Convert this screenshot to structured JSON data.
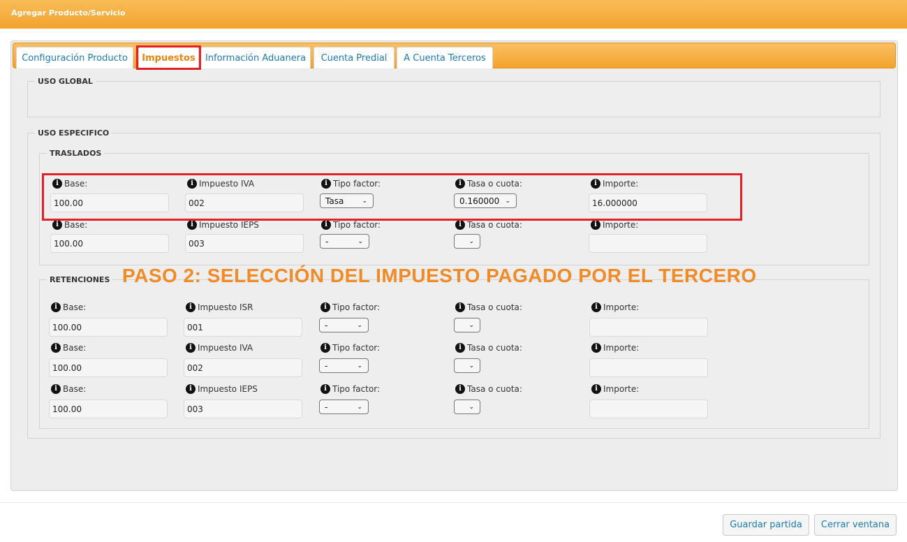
{
  "window": {
    "title": "Agregar Producto/Servicio"
  },
  "tabs": [
    {
      "label": "Configuración Producto"
    },
    {
      "label": "Impuestos"
    },
    {
      "label": "Información Aduanera"
    },
    {
      "label": "Cuenta Predial"
    },
    {
      "label": "A Cuenta Terceros"
    }
  ],
  "uso_global": {
    "legend": "USO GLOBAL"
  },
  "uso_especifico": {
    "legend": "USO ESPECIFICO"
  },
  "traslados": {
    "legend": "TRASLADOS",
    "rows": [
      {
        "base_label": "Base:",
        "base": "100.00",
        "impuesto_label": "Impuesto IVA",
        "impuesto": "002",
        "tipo_label": "Tipo factor:",
        "tipo": "Tasa",
        "tasa_label": "Tasa o cuota:",
        "tasa": "0.160000",
        "importe_label": "Importe:",
        "importe": "16.000000"
      },
      {
        "base_label": "Base:",
        "base": "100.00",
        "impuesto_label": "Impuesto IEPS",
        "impuesto": "003",
        "tipo_label": "Tipo factor:",
        "tipo": "-",
        "tasa_label": "Tasa o cuota:",
        "tasa": "",
        "importe_label": "Importe:",
        "importe": ""
      }
    ]
  },
  "overlay": {
    "text": "PASO 2: SELECCIÓN DEL IMPUESTO PAGADO POR EL TERCERO"
  },
  "retenciones": {
    "legend": "RETENCIONES",
    "rows": [
      {
        "base_label": "Base:",
        "base": "100.00",
        "impuesto_label": "Impuesto ISR",
        "impuesto": "001",
        "tipo_label": "Tipo factor:",
        "tipo": "-",
        "tasa_label": "Tasa o cuota:",
        "tasa": "",
        "importe_label": "Importe:",
        "importe": ""
      },
      {
        "base_label": "Base:",
        "base": "100.00",
        "impuesto_label": "Impuesto IVA",
        "impuesto": "002",
        "tipo_label": "Tipo factor:",
        "tipo": "-",
        "tasa_label": "Tasa o cuota:",
        "tasa": "",
        "importe_label": "Importe:",
        "importe": ""
      },
      {
        "base_label": "Base:",
        "base": "100.00",
        "impuesto_label": "Impuesto IEPS",
        "impuesto": "003",
        "tipo_label": "Tipo factor:",
        "tipo": "-",
        "tasa_label": "Tasa o cuota:",
        "tasa": "",
        "importe_label": "Importe:",
        "importe": ""
      }
    ]
  },
  "footer": {
    "save_label": "Guardar partida",
    "close_label": "Cerrar ventana"
  },
  "colors": {
    "accent": "#f3a32e",
    "highlight": "#e32026",
    "link": "#1d7ab8",
    "overlay": "#f28a26"
  }
}
